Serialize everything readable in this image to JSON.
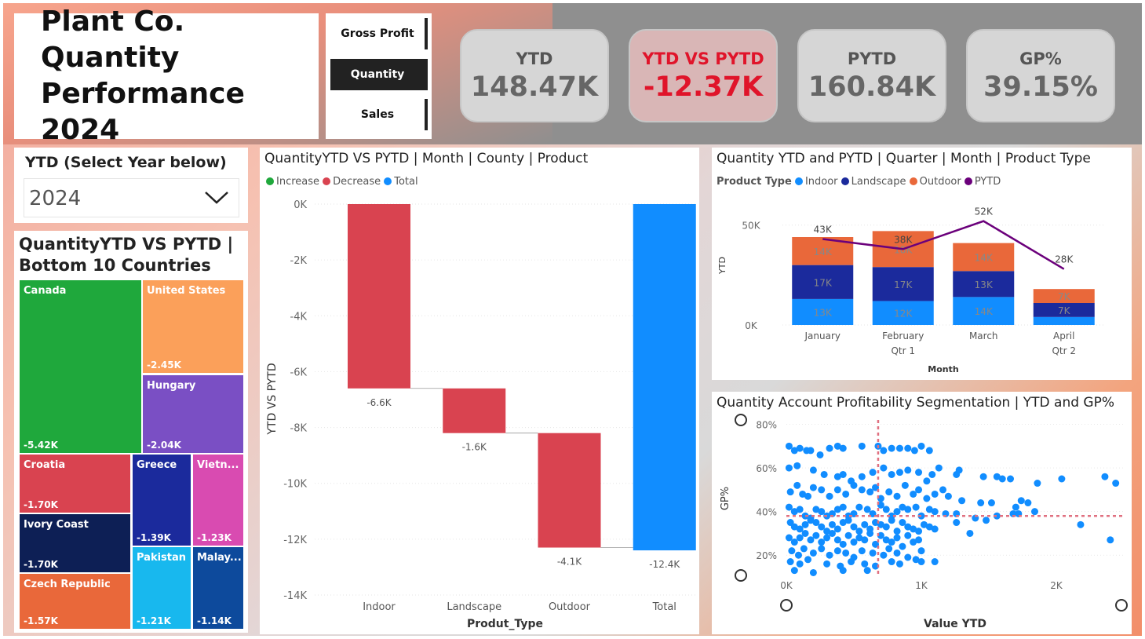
{
  "header": {
    "title": "Plant Co. Quantity Performance 2024"
  },
  "nav": [
    {
      "label": "Gross Profit",
      "active": false
    },
    {
      "label": "Quantity",
      "active": true
    },
    {
      "label": "Sales",
      "active": false
    }
  ],
  "kpis": [
    {
      "label": "YTD",
      "value": "148.47K"
    },
    {
      "label": "YTD VS PYTD",
      "value": "-12.37K"
    },
    {
      "label": "PYTD",
      "value": "160.84K"
    },
    {
      "label": "GP%",
      "value": "39.15%"
    }
  ],
  "slicer": {
    "title": "YTD (Select Year below)",
    "selected": "2024",
    "chevron_icon": "chevron-down-icon"
  },
  "treemap": {
    "title": "QuantityYTD VS PYTD | Bottom 10 Countries",
    "tiles": [
      {
        "name": "Canada",
        "value": "-5.42K",
        "color": "#1fa83c"
      },
      {
        "name": "United States",
        "value": "-2.45K",
        "color": "#fba05a"
      },
      {
        "name": "Hungary",
        "value": "-2.04K",
        "color": "#7a4fc4"
      },
      {
        "name": "Croatia",
        "value": "-1.70K",
        "color": "#d94350"
      },
      {
        "name": "Greece",
        "value": "-1.39K",
        "color": "#1b2a9c"
      },
      {
        "name": "Vietn...",
        "value": "-1.23K",
        "color": "#d94bb1"
      },
      {
        "name": "Ivory Coast",
        "value": "-1.70K",
        "color": "#0d1f55"
      },
      {
        "name": "Czech Republic",
        "value": "-1.57K",
        "color": "#e9683a"
      },
      {
        "name": "Pakistan",
        "value": "-1.21K",
        "color": "#18b8ee"
      },
      {
        "name": "Malay...",
        "value": "-1.14K",
        "color": "#0d4a9c"
      }
    ]
  },
  "waterfall": {
    "title": "QuantityYTD VS PYTD | Month | County | Product",
    "legend": [
      {
        "label": "Increase",
        "color": "#1fa83c"
      },
      {
        "label": "Decrease",
        "color": "#d94350"
      },
      {
        "label": "Total",
        "color": "#118dff"
      }
    ],
    "chart_data": {
      "type": "bar",
      "subtype": "waterfall",
      "categories": [
        "Indoor",
        "Landscape",
        "Outdoor",
        "Total"
      ],
      "values": [
        -6.6,
        -1.6,
        -4.1,
        -12.4
      ],
      "data_labels": [
        "-6.6K",
        "-1.6K",
        "-4.1K",
        "-12.4K"
      ],
      "xlabel": "Produt_Type",
      "ylabel": "YTD VS PYTD",
      "ylim": [
        -14,
        0
      ],
      "yticks": [
        "0K",
        "-2K",
        "-4K",
        "-6K",
        "-8K",
        "-10K",
        "-12K",
        "-14K"
      ]
    }
  },
  "column": {
    "title": "Quantity YTD and PYTD | Quarter | Month | Product Type",
    "legend_title": "Product Type",
    "legend": [
      {
        "label": "Indoor",
        "color": "#118dff"
      },
      {
        "label": "Landscape",
        "color": "#1b2a9c"
      },
      {
        "label": "Outdoor",
        "color": "#e9683a"
      },
      {
        "label": "PYTD",
        "color": "#6b007b"
      }
    ],
    "chart_data": {
      "type": "bar",
      "stacked": true,
      "categories": [
        "January",
        "February",
        "March",
        "April"
      ],
      "quarters": [
        "Qtr 1",
        "Qtr 1",
        "Qtr 1",
        "Qtr 2"
      ],
      "quarter_labels": [
        "Qtr 1",
        "Qtr 2"
      ],
      "series": [
        {
          "name": "Indoor",
          "values": [
            13,
            12,
            14,
            4
          ],
          "labels": [
            "13K",
            "12K",
            "14K",
            ""
          ]
        },
        {
          "name": "Landscape",
          "values": [
            17,
            17,
            13,
            7
          ],
          "labels": [
            "17K",
            "17K",
            "13K",
            "7K"
          ]
        },
        {
          "name": "Outdoor",
          "values": [
            14,
            18,
            14,
            7
          ],
          "labels": [
            "14K",
            "18K",
            "14K",
            "7K"
          ]
        },
        {
          "name": "PYTD",
          "type": "line",
          "values": [
            43,
            38,
            52,
            28
          ],
          "labels": [
            "43K",
            "38K",
            "52K",
            "28K"
          ]
        }
      ],
      "xlabel": "Month",
      "ylabel": "YTD",
      "ylim": [
        0,
        55
      ],
      "yticks": [
        "0K",
        "50K"
      ]
    }
  },
  "scatter": {
    "title": "Quantity Account Profitability Segmentation | YTD and GP%",
    "chart_data": {
      "type": "scatter",
      "xlabel": "Value YTD",
      "ylabel": "GP%",
      "xlim": [
        0,
        2500
      ],
      "ylim": [
        10,
        82
      ],
      "xticks": [
        "0K",
        "1K",
        "2K"
      ],
      "yticks": [
        "20%",
        "40%",
        "60%",
        "80%"
      ],
      "ref_x": 680,
      "ref_y": 38,
      "points": [
        [
          20,
          70
        ],
        [
          60,
          68
        ],
        [
          100,
          69
        ],
        [
          150,
          68
        ],
        [
          180,
          68
        ],
        [
          250,
          66
        ],
        [
          320,
          69
        ],
        [
          380,
          70
        ],
        [
          420,
          69
        ],
        [
          560,
          70
        ],
        [
          680,
          70
        ],
        [
          720,
          68
        ],
        [
          780,
          69
        ],
        [
          840,
          69
        ],
        [
          900,
          69
        ],
        [
          950,
          68
        ],
        [
          1000,
          70
        ],
        [
          1060,
          68
        ],
        [
          20,
          60
        ],
        [
          80,
          61
        ],
        [
          200,
          59
        ],
        [
          280,
          57
        ],
        [
          380,
          56
        ],
        [
          420,
          57
        ],
        [
          480,
          54
        ],
        [
          560,
          56
        ],
        [
          640,
          58
        ],
        [
          720,
          60
        ],
        [
          780,
          57
        ],
        [
          840,
          58
        ],
        [
          900,
          59
        ],
        [
          980,
          58
        ],
        [
          1040,
          54
        ],
        [
          1080,
          57
        ],
        [
          1130,
          60
        ],
        [
          1260,
          57
        ],
        [
          1280,
          59
        ],
        [
          1460,
          56
        ],
        [
          1560,
          56
        ],
        [
          1600,
          55
        ],
        [
          1660,
          55
        ],
        [
          1860,
          53
        ],
        [
          2040,
          55
        ],
        [
          2360,
          56
        ],
        [
          2440,
          53
        ],
        [
          30,
          49
        ],
        [
          80,
          52
        ],
        [
          120,
          48
        ],
        [
          160,
          47
        ],
        [
          200,
          51
        ],
        [
          260,
          50
        ],
        [
          320,
          47
        ],
        [
          380,
          50
        ],
        [
          440,
          48
        ],
        [
          500,
          52
        ],
        [
          560,
          50
        ],
        [
          620,
          49
        ],
        [
          660,
          51
        ],
        [
          700,
          46
        ],
        [
          760,
          49
        ],
        [
          820,
          47
        ],
        [
          880,
          52
        ],
        [
          940,
          48
        ],
        [
          980,
          50
        ],
        [
          1040,
          46
        ],
        [
          1100,
          48
        ],
        [
          1160,
          50
        ],
        [
          1200,
          47
        ],
        [
          1300,
          45
        ],
        [
          1440,
          44
        ],
        [
          1520,
          44
        ],
        [
          1700,
          42
        ],
        [
          1740,
          45
        ],
        [
          1790,
          44
        ],
        [
          1840,
          40
        ],
        [
          20,
          42
        ],
        [
          60,
          40
        ],
        [
          100,
          41
        ],
        [
          140,
          38
        ],
        [
          180,
          37
        ],
        [
          220,
          41
        ],
        [
          260,
          40
        ],
        [
          300,
          38
        ],
        [
          340,
          39
        ],
        [
          380,
          41
        ],
        [
          420,
          42
        ],
        [
          460,
          38
        ],
        [
          500,
          39
        ],
        [
          540,
          42
        ],
        [
          600,
          41
        ],
        [
          640,
          39
        ],
        [
          700,
          43
        ],
        [
          740,
          41
        ],
        [
          780,
          38
        ],
        [
          820,
          40
        ],
        [
          860,
          42
        ],
        [
          900,
          41
        ],
        [
          960,
          42
        ],
        [
          1000,
          38
        ],
        [
          1060,
          41
        ],
        [
          1100,
          40
        ],
        [
          1180,
          39
        ],
        [
          1260,
          39
        ],
        [
          1400,
          37
        ],
        [
          1480,
          36
        ],
        [
          1560,
          38
        ],
        [
          1680,
          39
        ],
        [
          1720,
          39
        ],
        [
          2180,
          34
        ],
        [
          30,
          35
        ],
        [
          60,
          33
        ],
        [
          100,
          32
        ],
        [
          140,
          34
        ],
        [
          180,
          36
        ],
        [
          220,
          35
        ],
        [
          260,
          33
        ],
        [
          300,
          31
        ],
        [
          340,
          34
        ],
        [
          380,
          32
        ],
        [
          420,
          35
        ],
        [
          460,
          36
        ],
        [
          500,
          33
        ],
        [
          540,
          31
        ],
        [
          580,
          34
        ],
        [
          620,
          32
        ],
        [
          660,
          35
        ],
        [
          700,
          34
        ],
        [
          740,
          33
        ],
        [
          780,
          36
        ],
        [
          820,
          31
        ],
        [
          860,
          35
        ],
        [
          900,
          33
        ],
        [
          940,
          32
        ],
        [
          980,
          31
        ],
        [
          1020,
          34
        ],
        [
          1060,
          33
        ],
        [
          1100,
          32
        ],
        [
          1260,
          35
        ],
        [
          1360,
          30
        ],
        [
          2400,
          27
        ],
        [
          20,
          28
        ],
        [
          60,
          26
        ],
        [
          100,
          28
        ],
        [
          140,
          30
        ],
        [
          180,
          27
        ],
        [
          220,
          29
        ],
        [
          260,
          26
        ],
        [
          300,
          28
        ],
        [
          340,
          30
        ],
        [
          380,
          27
        ],
        [
          420,
          25
        ],
        [
          460,
          29
        ],
        [
          500,
          26
        ],
        [
          540,
          28
        ],
        [
          580,
          27
        ],
        [
          620,
          30
        ],
        [
          660,
          25
        ],
        [
          700,
          29
        ],
        [
          740,
          27
        ],
        [
          780,
          26
        ],
        [
          820,
          28
        ],
        [
          860,
          24
        ],
        [
          900,
          29
        ],
        [
          940,
          26
        ],
        [
          980,
          27
        ],
        [
          40,
          22
        ],
        [
          90,
          20
        ],
        [
          130,
          23
        ],
        [
          200,
          21
        ],
        [
          260,
          23
        ],
        [
          320,
          20
        ],
        [
          380,
          22
        ],
        [
          440,
          21
        ],
        [
          500,
          19
        ],
        [
          560,
          22
        ],
        [
          640,
          21
        ],
        [
          720,
          20
        ],
        [
          760,
          23
        ],
        [
          820,
          21
        ],
        [
          900,
          19
        ],
        [
          960,
          18
        ],
        [
          1000,
          22
        ],
        [
          30,
          17
        ],
        [
          100,
          16
        ],
        [
          160,
          18
        ],
        [
          300,
          16
        ],
        [
          400,
          15
        ],
        [
          480,
          17
        ],
        [
          580,
          16
        ],
        [
          660,
          15
        ],
        [
          780,
          17
        ],
        [
          840,
          16
        ],
        [
          1000,
          17
        ],
        [
          1100,
          17
        ],
        [
          60,
          13
        ],
        [
          200,
          12
        ],
        [
          420,
          13
        ],
        [
          600,
          13
        ]
      ]
    }
  }
}
